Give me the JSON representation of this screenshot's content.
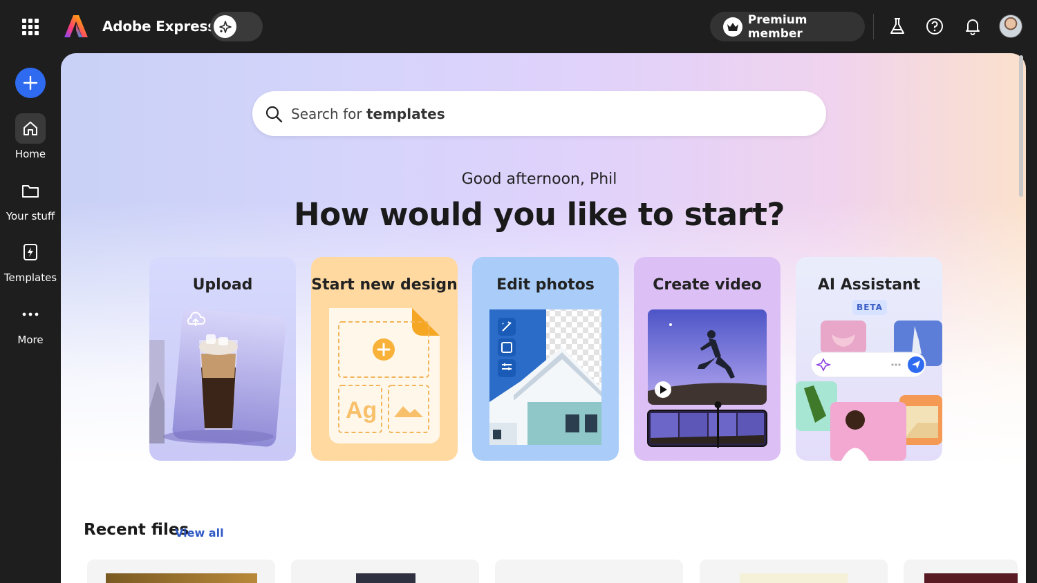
{
  "app": {
    "title": "Adobe Express"
  },
  "header": {
    "premium_label": "Premium member"
  },
  "sidebar": {
    "items": [
      {
        "label": "Home"
      },
      {
        "label": "Your stuff"
      },
      {
        "label": "Templates"
      },
      {
        "label": "More"
      }
    ]
  },
  "search": {
    "placeholder_prefix": "Search for",
    "placeholder_term": "templates"
  },
  "greeting": "Good afternoon, Phil",
  "headline": "How would you like to start?",
  "cards": [
    {
      "title": "Upload"
    },
    {
      "title": "Start new design"
    },
    {
      "title": "Edit photos"
    },
    {
      "title": "Create video"
    },
    {
      "title": "AI Assistant",
      "badge": "BETA"
    }
  ],
  "design_card": {
    "placeholder_text": "Ag"
  },
  "recent": {
    "title": "Recent files",
    "view_all": "View all"
  },
  "colors": {
    "accent": "#2f6bf0",
    "topbar": "#1e1e1e",
    "link": "#2f59c6"
  }
}
